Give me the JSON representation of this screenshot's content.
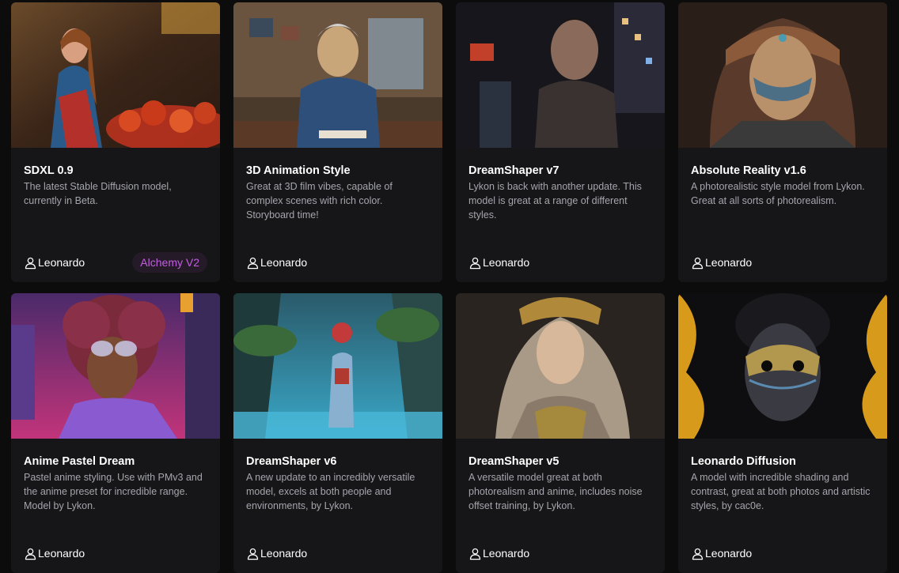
{
  "models": [
    {
      "title": "SDXL 0.9",
      "description": "The latest Stable Diffusion model, currently in Beta.",
      "author": "Leonardo",
      "badge": "Alchemy V2",
      "thumb_colors": [
        "#3a2518",
        "#b4462a",
        "#2a5a8a",
        "#d8703a"
      ]
    },
    {
      "title": "3D Animation Style",
      "description": "Great at 3D film vibes, capable of complex scenes with rich color. Storyboard time!",
      "author": "Leonardo",
      "thumb_colors": [
        "#4a3a2c",
        "#8a6a4a",
        "#2e4f7a",
        "#c9a67a"
      ]
    },
    {
      "title": "DreamShaper v7",
      "description": "Lykon is back with another update. This model is great at a range of different styles.",
      "author": "Leonardo",
      "thumb_colors": [
        "#1a1a22",
        "#3a3230",
        "#c2402a",
        "#8a6a5a"
      ]
    },
    {
      "title": "Absolute Reality v1.6",
      "description": "A photorealistic style model from Lykon. Great at all sorts of photorealism.",
      "author": "Leonardo",
      "thumb_colors": [
        "#2a1e18",
        "#6a4a38",
        "#3a6a8a",
        "#b8906a"
      ]
    },
    {
      "title": "Anime Pastel Dream",
      "description": "Pastel anime styling. Use with PMv3 and the anime preset for incredible range. Model by Lykon.",
      "author": "Leonardo",
      "thumb_colors": [
        "#3a1a4a",
        "#c2347a",
        "#7a3a2a",
        "#e84a8a"
      ]
    },
    {
      "title": "DreamShaper v6",
      "description": "A new update to an incredibly versatile model, excels at both people and environments, by Lykon.",
      "author": "Leonardo",
      "thumb_colors": [
        "#1f4a5a",
        "#3a8aa8",
        "#6ab8d0",
        "#c23a3a"
      ]
    },
    {
      "title": "DreamShaper v5",
      "description": "A versatile model great at both photorealism and anime, includes noise offset training, by Lykon.",
      "author": "Leonardo",
      "thumb_colors": [
        "#2a2420",
        "#8a7a6a",
        "#c8a888",
        "#b08a3a"
      ]
    },
    {
      "title": "Leonardo Diffusion",
      "description": "A model with incredible shading and contrast, great at both photos and artistic styles, by cac0e.",
      "author": "Leonardo",
      "thumb_colors": [
        "#0e0e10",
        "#d89a1a",
        "#3a3a42",
        "#5a8ab0"
      ]
    }
  ],
  "accent_badge_color": "#c45ee0",
  "icons": {
    "author": "user-icon"
  }
}
